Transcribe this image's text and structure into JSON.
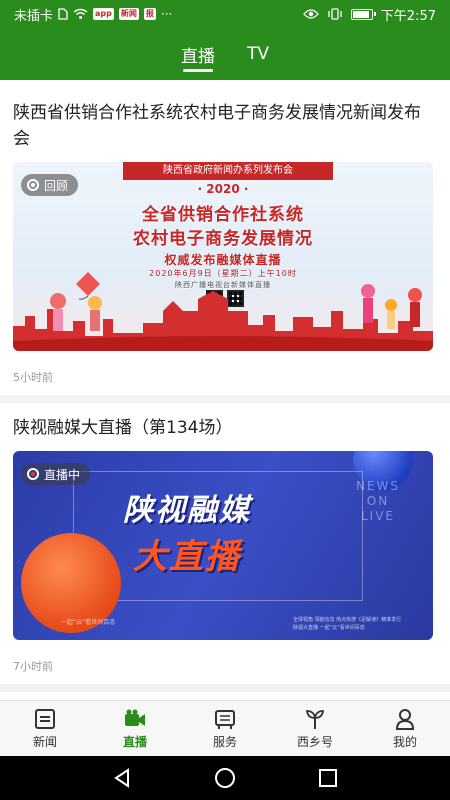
{
  "status_bar": {
    "left_text": "未插卡",
    "badge1": "app",
    "badge2": "新闻",
    "badge3": "报",
    "time": "下午2:57"
  },
  "header": {
    "tabs": [
      {
        "label": "直播",
        "active": true
      },
      {
        "label": "TV",
        "active": false
      }
    ]
  },
  "feed": [
    {
      "title": "陕西省供销合作社系统农村电子商务发展情况新闻发布会",
      "badge": "回顾",
      "time": "5小时前",
      "poster": {
        "banner": "陕西省政府新闻办系列发布会",
        "year": "· 2020 ·",
        "line1": "全省供销合作社系统",
        "line2": "农村电子商务发展情况",
        "line3": "权威发布融媒体直播",
        "line4": "2020年6月9日（星期二）上午10时",
        "line5": "陕西广播电视台新媒体直播"
      }
    },
    {
      "title": "陕视融媒大直播（第134场）",
      "badge": "直播中",
      "time": "7小时前",
      "poster": {
        "line1": "陕视融媒",
        "line2": "大直播",
        "live_text": "NEWS ON LIVE",
        "small_left": "一起“云”看世间百态",
        "small_right": "全球视角 领航信息 热点热搜《足解读》精准发行 陕视大直播 一起“云”看世间百态"
      }
    }
  ],
  "bottom_nav": [
    {
      "label": "新闻",
      "icon": "news-icon",
      "active": false
    },
    {
      "label": "直播",
      "icon": "video-camera-icon",
      "active": true
    },
    {
      "label": "服务",
      "icon": "service-icon",
      "active": false
    },
    {
      "label": "西乡号",
      "icon": "sprout-icon",
      "active": false
    },
    {
      "label": "我的",
      "icon": "user-icon",
      "active": false
    }
  ],
  "colors": {
    "brand": "#2b8c1e",
    "poster_red": "#c62828"
  }
}
